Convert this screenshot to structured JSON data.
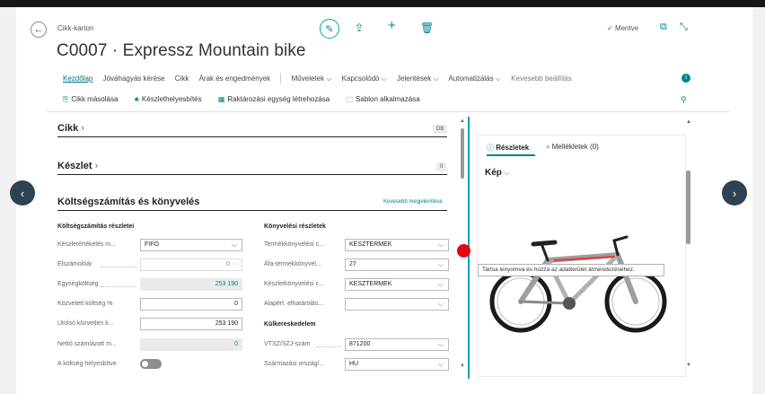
{
  "header": {
    "breadcrumb": "Cikk-karton",
    "title": "C0007 · Expressz Mountain bike",
    "saved_label": "Mentve"
  },
  "nav": {
    "items": [
      {
        "label": "Kezdőlap",
        "active": true
      },
      {
        "label": "Jóváhagyás kérése"
      },
      {
        "label": "Cikk"
      },
      {
        "label": "Árak és engedmények"
      },
      {
        "label": "Műveletek"
      },
      {
        "label": "Kapcsolódó"
      },
      {
        "label": "Jelentések"
      },
      {
        "label": "Automatizálás"
      },
      {
        "label": "Kevesebb beállítás"
      }
    ]
  },
  "actions": {
    "copy": "Cikk másolása",
    "stock_location": "Készlethelyesbítés",
    "warehouse_unit": "Raktározási egység létrehozása",
    "template": "Sablon alkalmazása"
  },
  "sections": {
    "cikk": {
      "title": "Cikk",
      "badge": "DB"
    },
    "keszlet": {
      "title": "Készlet",
      "badge": "0"
    },
    "cost": {
      "title": "Költségszámítás és könyvelés",
      "show_less": "Kevesebb megjelenítése"
    }
  },
  "cost_details": {
    "heading": "Költségszámítás részletei",
    "fields": [
      {
        "label": "Készletértékelés m...",
        "value": "FIFO"
      },
      {
        "label": "Elszámolóár",
        "value": "0"
      },
      {
        "label": "Egységköltség",
        "value": "253 190"
      },
      {
        "label": "Közvetett költség %",
        "value": "0"
      },
      {
        "label": "Utolsó közvetlen k...",
        "value": "253 190"
      },
      {
        "label": "Nettó számlázott m...",
        "value": "0"
      },
      {
        "label": "A költség helyesbítve",
        "value": ""
      }
    ]
  },
  "posting_details": {
    "heading": "Könyvelési részletek",
    "fields": [
      {
        "label": "Termékkönyvelési c...",
        "value": "KESZTERMEK"
      },
      {
        "label": "Áfa-termékkönyvel...",
        "value": "27"
      },
      {
        "label": "Készletkönyvelési c...",
        "value": "KESZTERMEK"
      },
      {
        "label": "Alapért. elhatárolás...",
        "value": ""
      }
    ]
  },
  "foreign_trade": {
    "heading": "Külkereskedelem",
    "fields": [
      {
        "label": "VTSZ/SZJ-szám",
        "value": "871200"
      },
      {
        "label": "Származási ország/...",
        "value": "HU"
      }
    ]
  },
  "factbox": {
    "tab_details": "Részletek",
    "tab_attachments": "Mellékletek (0)",
    "picture_title": "Kép",
    "tooltip": "Tartsa lenyomva és húzza az adatterület átméretezéséhez."
  },
  "colors": {
    "accent": "#00838f",
    "splitter": "#00a3b3",
    "marker": "#e30613",
    "nav_arrow": "#2f4251"
  }
}
